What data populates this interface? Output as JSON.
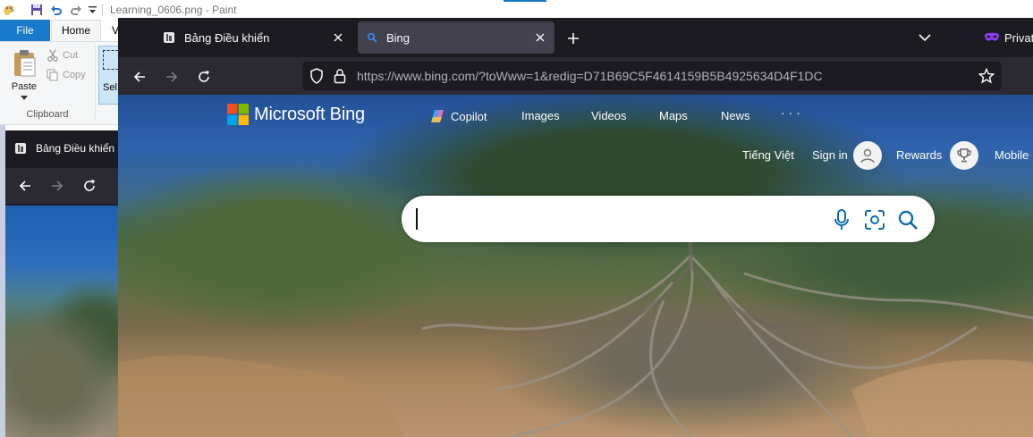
{
  "paint": {
    "title": "Learning_0606.png - Paint",
    "tabs": {
      "file": "File",
      "home": "Home",
      "view": "V"
    },
    "clipboard": {
      "paste": "Paste",
      "cut": "Cut",
      "copy": "Copy",
      "select": "Sel",
      "group_label": "Clipboard"
    }
  },
  "secondary_browser": {
    "tab_title": "Bảng Điều khiển"
  },
  "firefox": {
    "tabs": [
      {
        "title": "Bảng Điều khiển",
        "active": false
      },
      {
        "title": "Bing",
        "active": true
      }
    ],
    "private_label": "Private",
    "url": "https://www.bing.com/?toWww=1&redig=D71B69C5F4614159B5B4925634D4F1DC"
  },
  "bing": {
    "logo_text": "Microsoft Bing",
    "nav": [
      "Copilot",
      "Images",
      "Videos",
      "Maps",
      "News"
    ],
    "more": "· · ·",
    "language": "Tiếng Việt",
    "sign_in": "Sign in",
    "rewards": "Rewards",
    "mobile": "Mobile",
    "search": {
      "value": "",
      "placeholder": ""
    }
  },
  "colors": {
    "paint_accent": "#1979ca",
    "firefox_bg": "#1c1b22",
    "firefox_toolbar": "#2b2a33",
    "bing_icon_teal": "#0c6ea8",
    "private_purple": "#8f3eef"
  },
  "icons": [
    "paint-app-icon",
    "save-icon",
    "undo-icon",
    "redo-icon",
    "quick-access-dropdown-icon",
    "paste-icon",
    "cut-icon",
    "copy-icon",
    "select-icon",
    "firefox-tab-favicon",
    "bing-search-favicon",
    "close-icon",
    "plus-icon",
    "chevron-down-icon",
    "private-mask-icon",
    "back-icon",
    "forward-icon",
    "reload-icon",
    "shield-icon",
    "lock-icon",
    "star-icon",
    "microsoft-logo",
    "copilot-icon",
    "user-avatar-icon",
    "trophy-icon",
    "microphone-icon",
    "visual-search-icon",
    "search-icon"
  ]
}
